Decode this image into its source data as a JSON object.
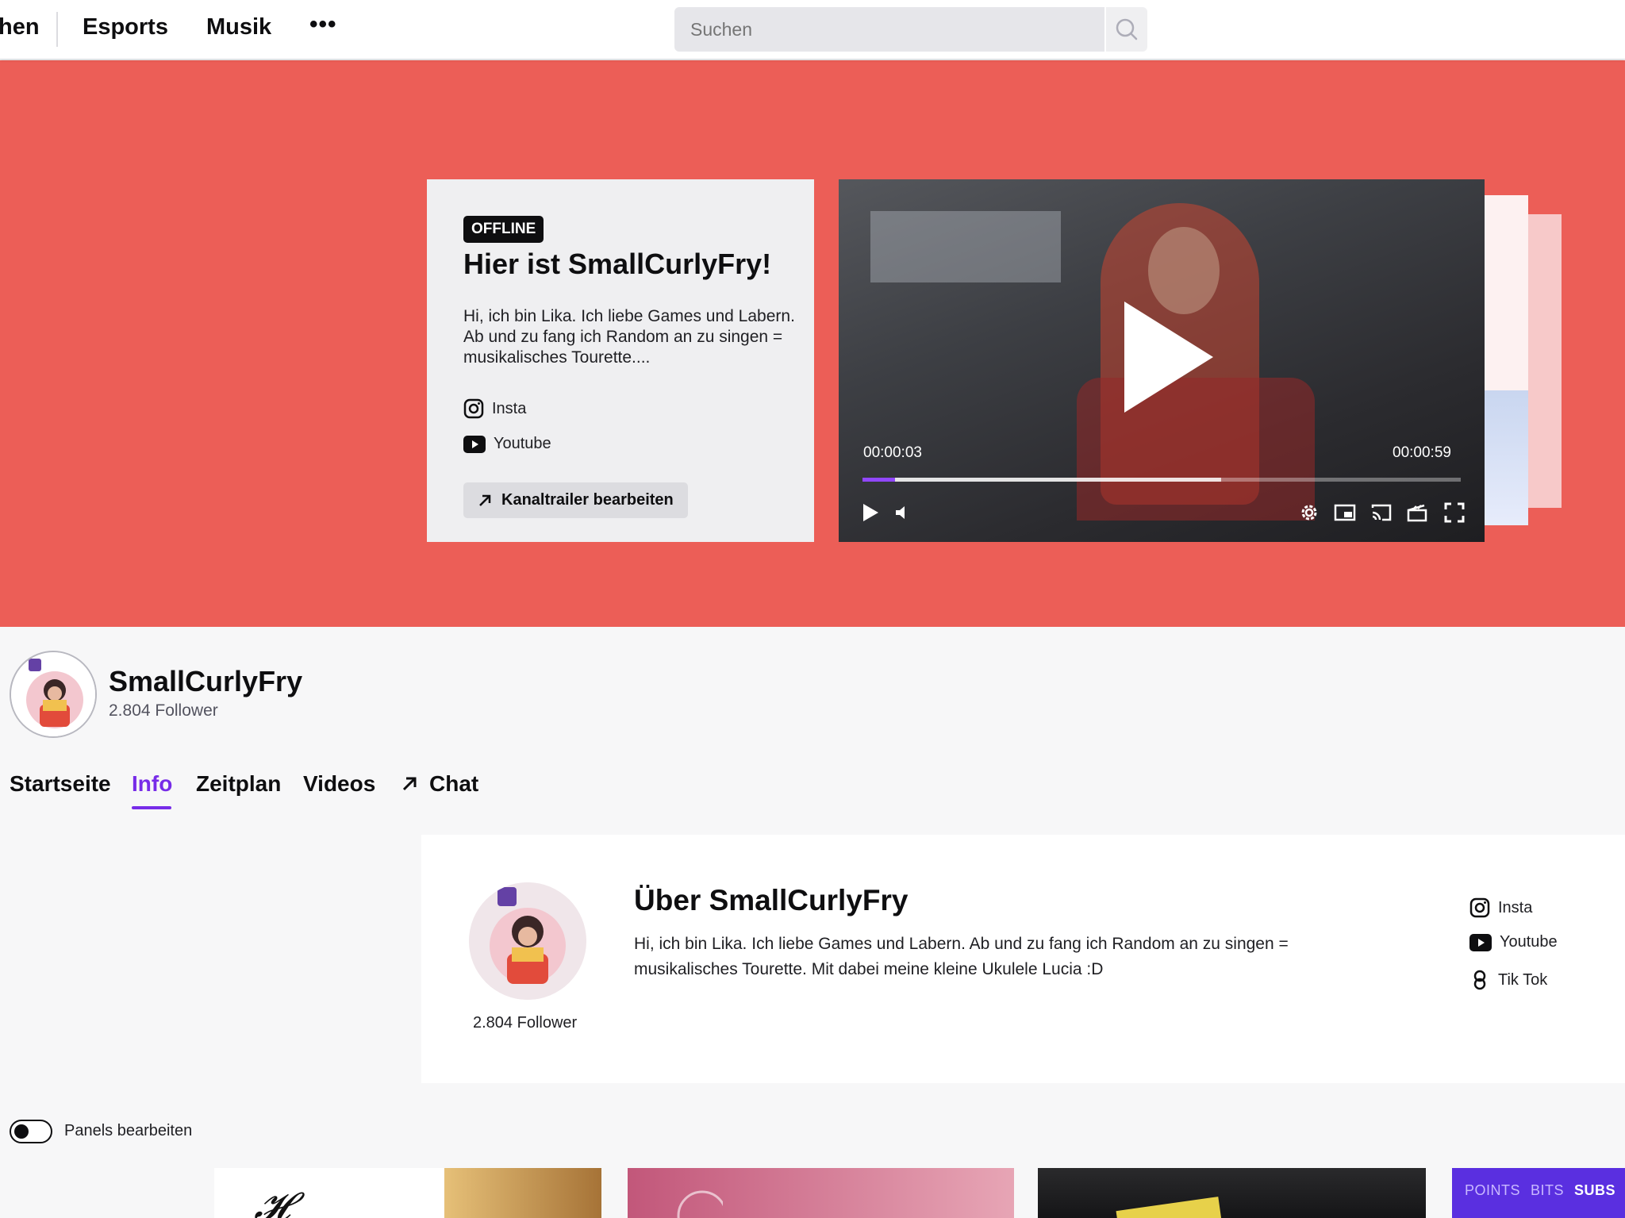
{
  "nav": {
    "partial_item": "hen",
    "esports": "Esports",
    "musik": "Musik",
    "more": "•••",
    "search_placeholder": "Suchen"
  },
  "hero": {
    "background": "#ec5e57",
    "badge": "OFFLINE",
    "title": "Hier ist SmallCurlyFry!",
    "description": "Hi, ich bin Lika. Ich liebe Games und Labern. Ab und zu fang ich Random an zu singen = musikalisches Tourette....",
    "links": [
      {
        "label": "Insta",
        "icon": "instagram-icon"
      },
      {
        "label": "Youtube",
        "icon": "youtube-icon"
      }
    ],
    "edit_trailer": "Kanaltrailer bearbeiten"
  },
  "player": {
    "current_time": "00:00:03",
    "total_time": "00:00:59",
    "progress": 0.055,
    "buffered": 0.6
  },
  "channel": {
    "name": "SmallCurlyFry",
    "followers": "2.804 Follower"
  },
  "tabs": [
    {
      "label": "Startseite"
    },
    {
      "label": "Info"
    },
    {
      "label": "Zeitplan"
    },
    {
      "label": "Videos"
    },
    {
      "label": "Chat"
    }
  ],
  "active_tab": "Info",
  "about": {
    "title": "Über SmallCurlyFry",
    "description": "Hi, ich bin Lika. Ich liebe Games und Labern. Ab und zu fang ich Random an zu singen = musikalisches Tourette. Mit dabei meine kleine Ukulele Lucia :D",
    "followers": "2.804 Follower",
    "links": [
      {
        "label": "Insta",
        "icon": "instagram-icon"
      },
      {
        "label": "Youtube",
        "icon": "youtube-icon"
      },
      {
        "label": "Tik Tok",
        "icon": "link-icon"
      }
    ]
  },
  "panels_toggle": {
    "label": "Panels bearbeiten",
    "on": false
  },
  "panel4": {
    "points": "POINTS",
    "bits": "BITS",
    "subs": "SUBS"
  },
  "colors": {
    "accent": "#772ce8",
    "brand_purple": "#9147ff"
  }
}
